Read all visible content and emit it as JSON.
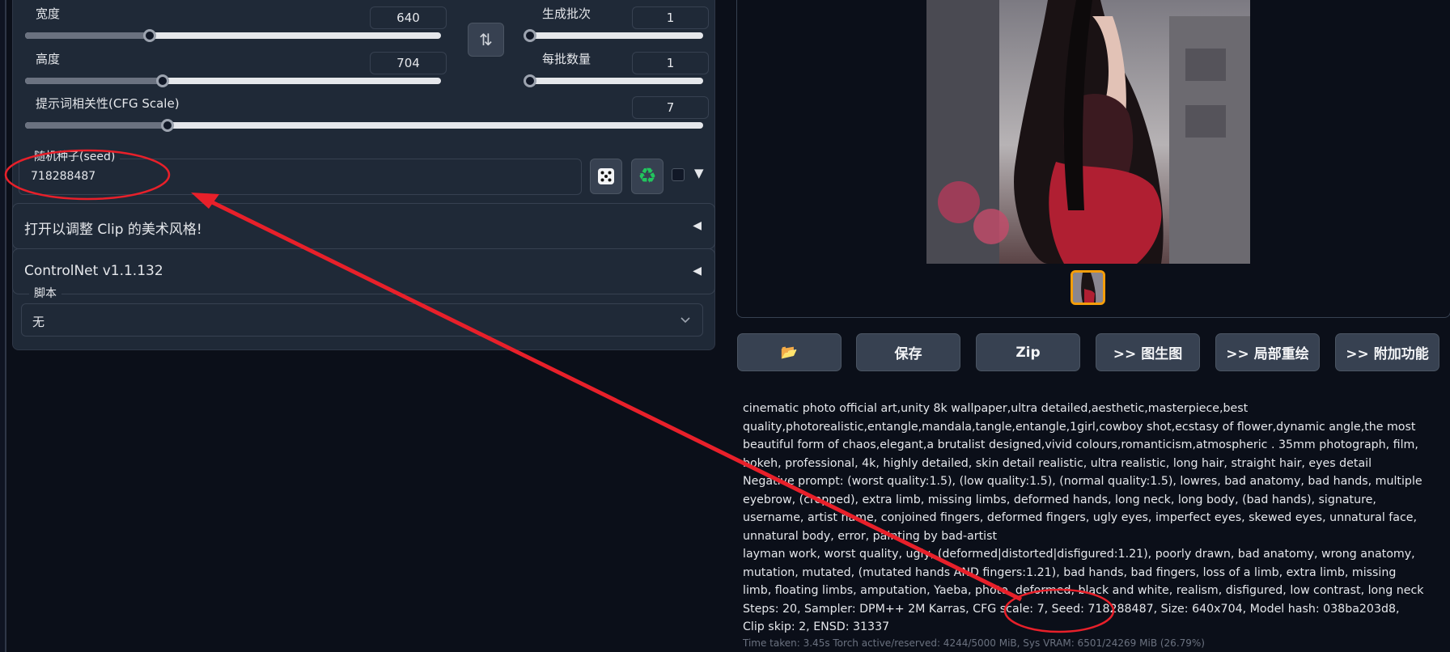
{
  "params": {
    "width": {
      "label": "宽度",
      "value": "640",
      "min": 64,
      "max": 2048,
      "fraction": 0.3
    },
    "height": {
      "label": "高度",
      "value": "704",
      "min": 64,
      "max": 2048,
      "fraction": 0.33
    },
    "batch_count": {
      "label": "生成批次",
      "value": "1",
      "fraction": 0.0
    },
    "batch_size": {
      "label": "每批数量",
      "value": "1",
      "fraction": 0.0
    },
    "cfg_scale": {
      "label": "提示词相关性(CFG Scale)",
      "value": "7",
      "fraction": 0.21
    },
    "swap_icon": "swap-vertical-icon"
  },
  "seed": {
    "label": "随机种子(seed)",
    "value": "718288487",
    "dice_icon": "dice-icon",
    "recycle_icon": "recycle-icon"
  },
  "accordions": [
    {
      "label": "打开以调整 Clip 的美术风格!",
      "arrow": "◀"
    },
    {
      "label": "ControlNet v1.1.132",
      "arrow": "◀"
    }
  ],
  "script": {
    "label": "脚本",
    "value": "无"
  },
  "actions": [
    "📂",
    "保存",
    "Zip",
    ">> 图生图",
    ">> 局部重绘",
    ">> 附加功能"
  ],
  "generation_info": {
    "prompt": "cinematic photo official art,unity 8k wallpaper,ultra detailed,aesthetic,masterpiece,best quality,photorealistic,entangle,mandala,tangle,entangle,1girl,cowboy shot,ecstasy of flower,dynamic angle,the most beautiful form of chaos,elegant,a brutalist designed,vivid colours,romanticism,atmospheric . 35mm photograph, film, bokeh, professional, 4k, highly detailed, skin detail realistic, ultra realistic, long hair, straight hair, eyes detail",
    "negative": "Negative prompt: (worst quality:1.5), (low quality:1.5), (normal quality:1.5), lowres, bad anatomy, bad hands, multiple eyebrow, (cropped), extra limb, missing limbs, deformed hands, long neck, long body, (bad hands), signature, username, artist name, conjoined fingers, deformed fingers, ugly eyes, imperfect eyes, skewed eyes, unnatural face, unnatural body, error, painting by bad-artist",
    "negative2": "layman work, worst quality, ugly, (deformed|distorted|disfigured:1.21), poorly drawn, bad anatomy, wrong anatomy, mutation, mutated, (mutated hands AND fingers:1.21), bad hands, bad fingers, loss of a limb, extra limb, missing limb, floating limbs, amputation, Yaeba, photo, deformed, black and white, realism, disfigured, low contrast, long neck",
    "params": "Steps: 20, Sampler: DPM++ 2M Karras, CFG scale: 7, Seed: 718288487, Size: 640x704, Model hash: 038ba203d8, Clip skip: 2, ENSD: 31337",
    "timing": "Time taken: 3.45s  Torch active/reserved: 4244/5000 MiB, Sys VRAM: 6501/24269 MiB (26.79%)"
  },
  "colors": {
    "annotation": "#e8202a",
    "accent_border": "#f59e0b",
    "panel": "#1f2937",
    "background": "#0b0f19"
  }
}
